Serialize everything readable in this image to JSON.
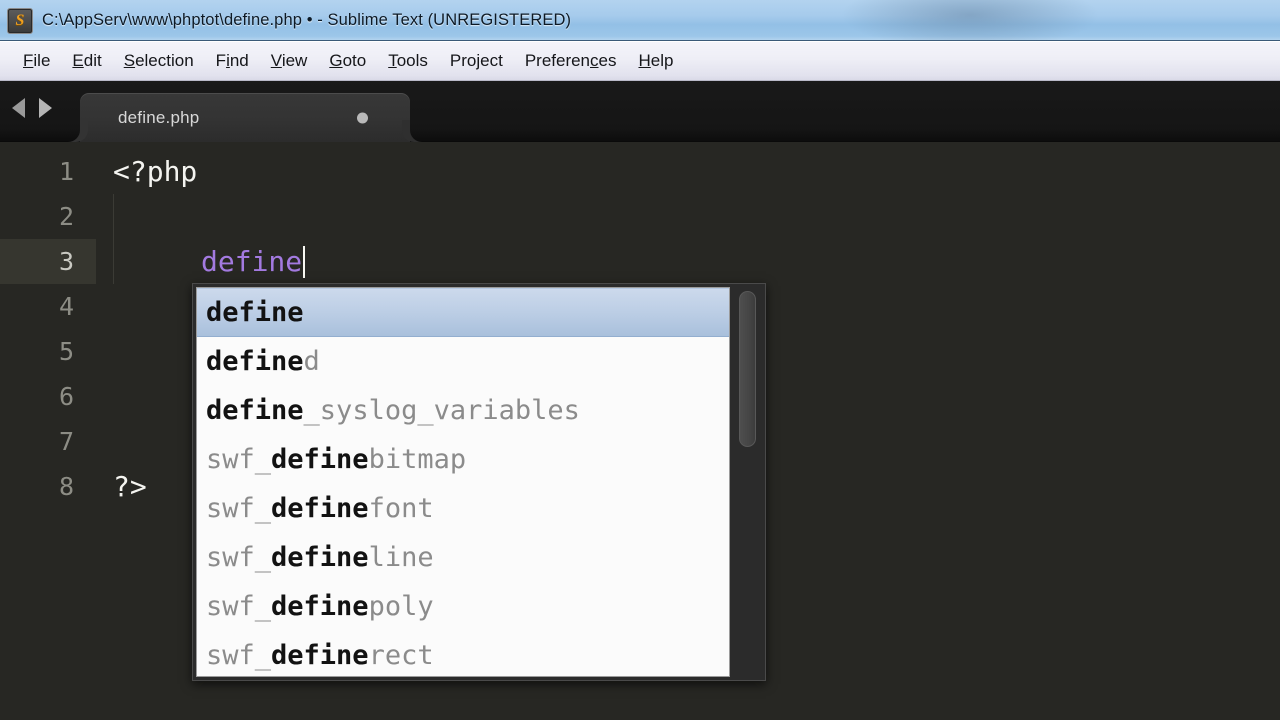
{
  "window": {
    "title": "C:\\AppServ\\www\\phptot\\define.php • - Sublime Text (UNREGISTERED)",
    "icon": "sublime-text-icon",
    "icon_letter": "S"
  },
  "menubar": {
    "items": [
      {
        "label": "File",
        "accel_index": 0
      },
      {
        "label": "Edit",
        "accel_index": 0
      },
      {
        "label": "Selection",
        "accel_index": 0
      },
      {
        "label": "Find",
        "accel_index": 1
      },
      {
        "label": "View",
        "accel_index": 0
      },
      {
        "label": "Goto",
        "accel_index": 0
      },
      {
        "label": "Tools",
        "accel_index": 0
      },
      {
        "label": "Project",
        "accel_index": -1
      },
      {
        "label": "Preferences",
        "accel_index": 8
      },
      {
        "label": "Help",
        "accel_index": 0
      }
    ]
  },
  "tabbar": {
    "prev_arrow": "arrow-left-icon",
    "next_arrow": "arrow-right-icon",
    "tabs": [
      {
        "label": "define.php",
        "active": true,
        "dirty": true
      }
    ]
  },
  "editor": {
    "active_line": 3,
    "cursor_line": 3,
    "lines": [
      {
        "num": "1",
        "indent": 0,
        "tokens": [
          {
            "text": "<?php",
            "style": "tag"
          }
        ]
      },
      {
        "num": "2",
        "indent": 0,
        "tokens": []
      },
      {
        "num": "3",
        "indent": 1,
        "tokens": [
          {
            "text": "define",
            "style": "fn"
          }
        ]
      },
      {
        "num": "4",
        "indent": 0,
        "tokens": []
      },
      {
        "num": "5",
        "indent": 0,
        "tokens": []
      },
      {
        "num": "6",
        "indent": 0,
        "tokens": []
      },
      {
        "num": "7",
        "indent": 0,
        "tokens": []
      },
      {
        "num": "8",
        "indent": 0,
        "tokens": [
          {
            "text": "?>",
            "style": "tag"
          }
        ]
      }
    ]
  },
  "autocomplete": {
    "query": "define",
    "selected_index": 0,
    "items": [
      {
        "prefix": "",
        "match": "define",
        "suffix": "",
        "selected": true
      },
      {
        "prefix": "",
        "match": "define",
        "suffix": "d",
        "selected": false
      },
      {
        "prefix": "",
        "match": "define",
        "suffix": "_syslog_variables",
        "selected": false
      },
      {
        "prefix": "swf_",
        "match": "define",
        "suffix": "bitmap",
        "selected": false
      },
      {
        "prefix": "swf_",
        "match": "define",
        "suffix": "font",
        "selected": false
      },
      {
        "prefix": "swf_",
        "match": "define",
        "suffix": "line",
        "selected": false
      },
      {
        "prefix": "swf_",
        "match": "define",
        "suffix": "poly",
        "selected": false
      },
      {
        "prefix": "swf_",
        "match": "define",
        "suffix": "rect",
        "selected": false
      }
    ],
    "scrollbar": {
      "thumb_top_pct": 1,
      "thumb_height_pct": 40
    }
  },
  "colors": {
    "titlebar_blue": "#a6cbec",
    "menubar_bg": "#eeeef6",
    "tabbar_bg": "#151515",
    "editor_bg": "#272723",
    "active_line_bg": "#36362f",
    "line_number": "#8d8d85",
    "function_purple": "#a37ae0",
    "tag_white": "#f4f4f0",
    "popup_bg": "#fbfbfb",
    "popup_selected": "#bccee5",
    "popup_match_text": "#121212",
    "popup_dim_text": "#8b8b8b",
    "icon_orange": "#f0a020"
  }
}
